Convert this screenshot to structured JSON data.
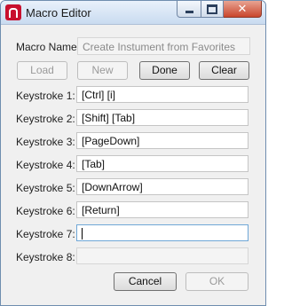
{
  "window": {
    "title": "Macro Editor",
    "close_glyph": "✕"
  },
  "macro_name": {
    "label": "Macro Name:",
    "value": "Create Instument from Favorites"
  },
  "toolbar": {
    "load_label": "Load",
    "new_label": "New",
    "done_label": "Done",
    "clear_label": "Clear"
  },
  "keystrokes": [
    {
      "label": "Keystroke 1:",
      "value": "[Ctrl] [i]"
    },
    {
      "label": "Keystroke 2:",
      "value": "[Shift] [Tab]"
    },
    {
      "label": "Keystroke 3:",
      "value": "[PageDown]"
    },
    {
      "label": "Keystroke 4:",
      "value": "[Tab]"
    },
    {
      "label": "Keystroke 5:",
      "value": "[DownArrow]"
    },
    {
      "label": "Keystroke 6:",
      "value": "[Return]"
    },
    {
      "label": "Keystroke 7:",
      "value": ""
    },
    {
      "label": "Keystroke 8:",
      "value": ""
    }
  ],
  "footer": {
    "cancel_label": "Cancel",
    "ok_label": "OK"
  },
  "colors": {
    "app_icon": "#c8102e",
    "close_button": "#c9462c"
  }
}
